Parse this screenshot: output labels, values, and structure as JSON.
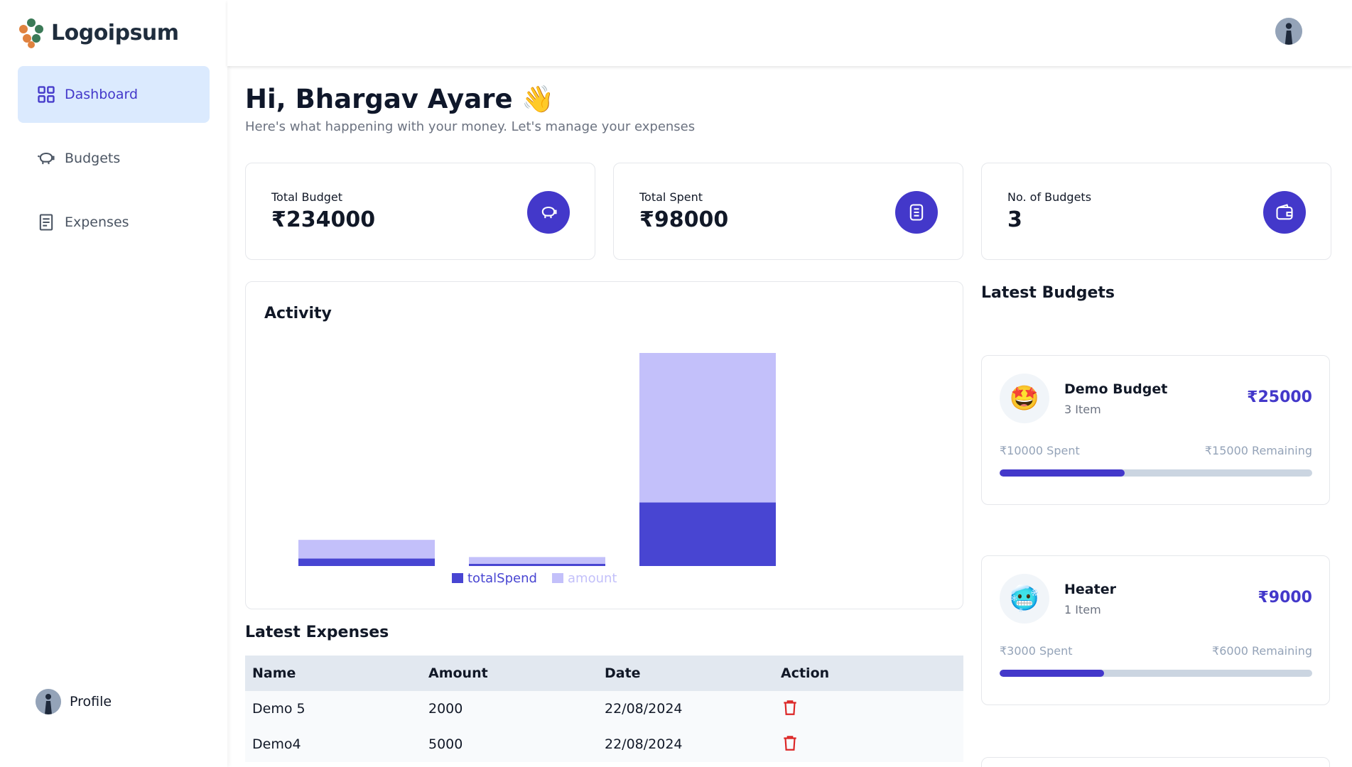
{
  "brand": {
    "name": "Logoipsum"
  },
  "sidebar": {
    "items": [
      {
        "label": "Dashboard",
        "icon": "grid-icon",
        "active": true
      },
      {
        "label": "Budgets",
        "icon": "piggy-bank-icon",
        "active": false
      },
      {
        "label": "Expenses",
        "icon": "receipt-icon",
        "active": false
      }
    ],
    "profile_label": "Profile"
  },
  "greeting": {
    "title": "Hi, Bhargav Ayare 👋",
    "subtitle": "Here's what happening with your money. Let's manage your expenses"
  },
  "stats": [
    {
      "label": "Total Budget",
      "value": "₹234000",
      "icon": "piggy-bank-icon"
    },
    {
      "label": "Total Spent",
      "value": "₹98000",
      "icon": "receipt-icon"
    },
    {
      "label": "No. of Budgets",
      "value": "3",
      "icon": "wallet-icon"
    }
  ],
  "activity": {
    "title": "Activity"
  },
  "chart_data": {
    "type": "bar",
    "stacked": true,
    "categories": [
      "",
      "",
      ""
    ],
    "series": [
      {
        "name": "totalSpend",
        "color": "#4845d2",
        "values": [
          10000,
          3000,
          85000
        ]
      },
      {
        "name": "amount",
        "color": "#c3c0fa",
        "values": [
          25000,
          9000,
          200000
        ]
      }
    ],
    "legend": "bottom-center",
    "grid": false
  },
  "expenses": {
    "title": "Latest Expenses",
    "headers": [
      "Name",
      "Amount",
      "Date",
      "Action"
    ],
    "rows": [
      {
        "name": "Demo 5",
        "amount": "2000",
        "date": "22/08/2024"
      },
      {
        "name": "Demo4",
        "amount": "5000",
        "date": "22/08/2024"
      }
    ]
  },
  "budgets": {
    "title": "Latest Budgets",
    "items": [
      {
        "emoji": "🤩",
        "name": "Demo Budget",
        "items": "3 Item",
        "amount": "₹25000",
        "spent": "₹10000 Spent",
        "remaining": "₹15000 Remaining",
        "progress": 0.4
      },
      {
        "emoji": "🥶",
        "name": "Heater",
        "items": "1 Item",
        "amount": "₹9000",
        "spent": "₹3000 Spent",
        "remaining": "₹6000 Remaining",
        "progress": 0.333
      }
    ]
  },
  "colors": {
    "accent": "#4338ca",
    "active_bg": "#dbeafe",
    "danger": "#dc2626"
  }
}
